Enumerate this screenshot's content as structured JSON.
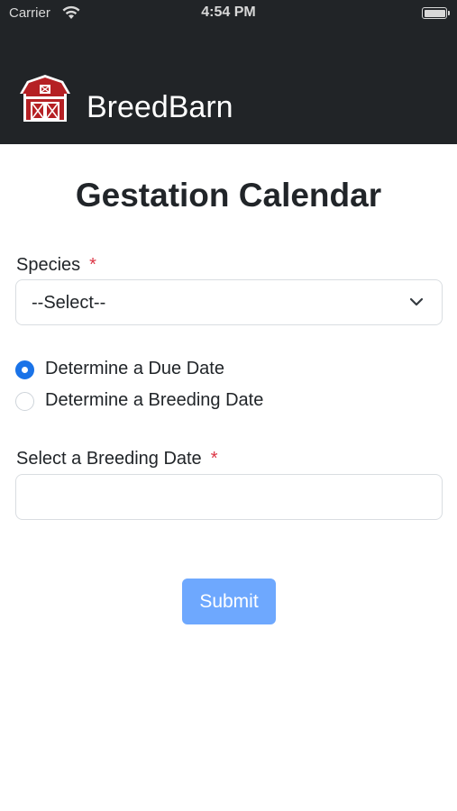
{
  "status_bar": {
    "carrier": "Carrier",
    "time": "4:54 PM"
  },
  "header": {
    "brand_name": "BreedBarn",
    "logo_icon": "barn-icon",
    "colors": {
      "background": "#212427",
      "logo_red": "#b52024"
    }
  },
  "page": {
    "title": "Gestation Calendar"
  },
  "form": {
    "species_label": "Species",
    "required_mark": "*",
    "species_select_value": "--Select--",
    "mode_options": [
      {
        "label": "Determine a Due Date",
        "selected": true
      },
      {
        "label": "Determine a Breeding Date",
        "selected": false
      }
    ],
    "date_label": "Select a Breeding Date",
    "date_value": "",
    "submit_label": "Submit",
    "colors": {
      "accent": "#1a73e8",
      "required": "#dc3545",
      "submit_disabled": "#6ea8fe"
    }
  }
}
